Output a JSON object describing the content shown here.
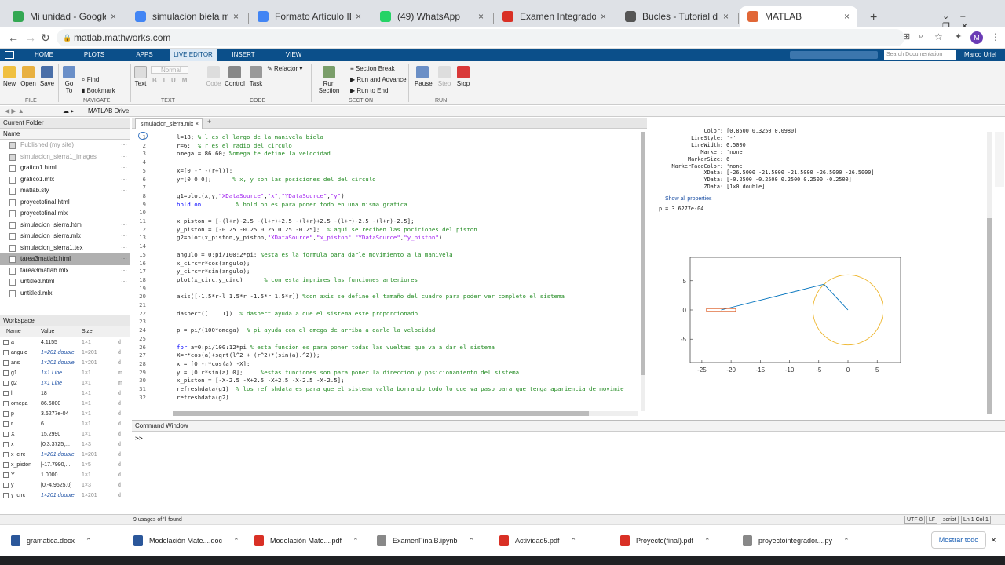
{
  "browser": {
    "tabs": [
      {
        "label": "Mi unidad - Google Drive",
        "color": "#34a853"
      },
      {
        "label": "simulacion biela manivela - Doc",
        "color": "#4285f4"
      },
      {
        "label": "Formato Artículo IEEE Eq. 4 - Do",
        "color": "#4285f4"
      },
      {
        "label": "(49) WhatsApp",
        "color": "#25d366"
      },
      {
        "label": "Examen Integrador - Parte práct",
        "color": "#d93025"
      },
      {
        "label": "Bucles - Tutorial de Python",
        "color": "#555555"
      },
      {
        "label": "MATLAB",
        "color": "#e16737"
      }
    ],
    "url": "matlab.mathworks.com",
    "new_tab": "+",
    "profile_initial": "M"
  },
  "matlab": {
    "tabs": [
      "HOME",
      "PLOTS",
      "APPS",
      "LIVE EDITOR",
      "INSERT",
      "VIEW"
    ],
    "search_placeholder": "Search Documentation",
    "user": "Marco Uriel",
    "toolstrip": {
      "file": [
        "New",
        "Open",
        "Save"
      ],
      "navigate": {
        "goto": "Go To",
        "find": "Find",
        "bookmark": "Bookmark"
      },
      "text": {
        "text": "Text",
        "style": "Normal",
        "fmt": [
          "B",
          "I",
          "U",
          "M"
        ]
      },
      "code": {
        "code": "Code",
        "control": "Control",
        "task": "Task",
        "refactor": "Refactor"
      },
      "section": [
        "Section Break",
        "Run and Advance",
        "Run to End"
      ],
      "run_section": "Run Section",
      "run": [
        "Pause",
        "Step",
        "Stop"
      ],
      "groups": [
        "FILE",
        "NAVIGATE",
        "TEXT",
        "CODE",
        "SECTION",
        "RUN"
      ]
    },
    "path": "MATLAB Drive",
    "current_folder": {
      "title": "Current Folder",
      "col_name": "Name",
      "files": [
        {
          "name": "Published (my site)",
          "dim": true
        },
        {
          "name": "simulacion_sierra1_images",
          "dim": true
        },
        {
          "name": "grafico1.html"
        },
        {
          "name": "grafico1.mlx"
        },
        {
          "name": "matlab.sty"
        },
        {
          "name": "proyectofinal.html"
        },
        {
          "name": "proyectofinal.mlx"
        },
        {
          "name": "simulacion_sierra.html"
        },
        {
          "name": "simulacion_sierra.mlx"
        },
        {
          "name": "simulacion_sierra1.tex"
        },
        {
          "name": "tarea3matlab.html",
          "selected": true
        },
        {
          "name": "tarea3matlab.mlx"
        },
        {
          "name": "untitled.html"
        },
        {
          "name": "untitled.mlx"
        }
      ]
    },
    "workspace": {
      "title": "Workspace",
      "headers": [
        "Name",
        "Value",
        "Size",
        ""
      ],
      "vars": [
        {
          "name": "a",
          "value": "4.1155",
          "size": "1×1",
          "cls": "d"
        },
        {
          "name": "angulo",
          "value": "1×201 double",
          "size": "1×201",
          "cls": "d",
          "link": true
        },
        {
          "name": "ans",
          "value": "1×201 double",
          "size": "1×201",
          "cls": "d",
          "link": true
        },
        {
          "name": "g1",
          "value": "1×1 Line",
          "size": "1×1",
          "cls": "m",
          "link": true
        },
        {
          "name": "g2",
          "value": "1×1 Line",
          "size": "1×1",
          "cls": "m",
          "link": true
        },
        {
          "name": "l",
          "value": "18",
          "size": "1×1",
          "cls": "d"
        },
        {
          "name": "omega",
          "value": "86.6000",
          "size": "1×1",
          "cls": "d"
        },
        {
          "name": "p",
          "value": "3.6277e-04",
          "size": "1×1",
          "cls": "d"
        },
        {
          "name": "r",
          "value": "6",
          "size": "1×1",
          "cls": "d"
        },
        {
          "name": "X",
          "value": "15.2990",
          "size": "1×1",
          "cls": "d"
        },
        {
          "name": "x",
          "value": "[0.3.3725,...",
          "size": "1×3",
          "cls": "d"
        },
        {
          "name": "x_circ",
          "value": "1×201 double",
          "size": "1×201",
          "cls": "d",
          "link": true
        },
        {
          "name": "x_piston",
          "value": "[-17.7990,...",
          "size": "1×5",
          "cls": "d"
        },
        {
          "name": "Y",
          "value": "1.0000",
          "size": "1×1",
          "cls": "d"
        },
        {
          "name": "y",
          "value": "[0,-4.9625,0]",
          "size": "1×3",
          "cls": "d"
        },
        {
          "name": "y_circ",
          "value": "1×201 double",
          "size": "1×201",
          "cls": "d",
          "link": true
        }
      ]
    },
    "editor_tab": "simulacion_sierra.mlx",
    "code_lines": [
      {
        "n": "1",
        "c": "l=18; % l es el largo de la manivela biela"
      },
      {
        "n": "2",
        "c": "r=6;  % r es el radio del circulo"
      },
      {
        "n": "3",
        "c": "omega = 86.60; %omega te define la velocidad"
      },
      {
        "n": "4",
        "c": ""
      },
      {
        "n": "5",
        "c": "x=[0 -r -(r+l)];"
      },
      {
        "n": "6",
        "c": "y=[0 0 0];      % x, y son las posiciones del del circulo"
      },
      {
        "n": "7",
        "c": ""
      },
      {
        "n": "8",
        "c": "g1=plot(x,y,\"XDataSource\",\"x\",\"YDataSource\",\"y\")"
      },
      {
        "n": "9",
        "c": "hold on          % hold on es para poner todo en una misma grafica"
      },
      {
        "n": "10",
        "c": ""
      },
      {
        "n": "11",
        "c": "x_piston = [-(l+r)-2.5 -(l+r)+2.5 -(l+r)+2.5 -(l+r)-2.5 -(l+r)-2.5];"
      },
      {
        "n": "12",
        "c": "y_piston = [-0.25 -0.25 0.25 0.25 -0.25];  % aqui se reciben las pociciones del piston"
      },
      {
        "n": "13",
        "c": "g2=plot(x_piston,y_piston,\"XDataSource\",\"x_piston\",\"YDataSource\",\"y_piston\")"
      },
      {
        "n": "14",
        "c": ""
      },
      {
        "n": "15",
        "c": "angulo = 0:pi/100:2*pi; %esta es la formula para darle movimiento a la manivela"
      },
      {
        "n": "16",
        "c": "x_circ=r*cos(angulo);"
      },
      {
        "n": "17",
        "c": "y_circ=r*sin(angulo);"
      },
      {
        "n": "18",
        "c": "plot(x_circ,y_circ)      % con esta imprimes las funciones anteriores"
      },
      {
        "n": "19",
        "c": ""
      },
      {
        "n": "20",
        "c": "axis([-1.5*r-l 1.5*r -1.5*r 1.5*r]) %con axis se define el tamaño del cuadro para poder ver completo el sistema"
      },
      {
        "n": "21",
        "c": ""
      },
      {
        "n": "22",
        "c": "daspect([1 1 1])  % daspect ayuda a que el sistema este proporcionado"
      },
      {
        "n": "23",
        "c": ""
      },
      {
        "n": "24",
        "c": "p = pi/(100*omega)  % pi ayuda con el omega de arriba a darle la velocidad"
      },
      {
        "n": "25",
        "c": ""
      },
      {
        "n": "26",
        "c": "for a=0:pi/100:12*pi % esta funcion es para poner todas las vueltas que va a dar el sistema"
      },
      {
        "n": "27",
        "c": "X=r*cos(a)+sqrt(l^2 + (r^2)*(sin(a).^2));"
      },
      {
        "n": "28",
        "c": "x = [0 -r*cos(a) -X];"
      },
      {
        "n": "29",
        "c": "y = [0 r*sin(a) 0];     %estas funciones son para poner la direccion y posicionamiento del sistema"
      },
      {
        "n": "30",
        "c": "x_piston = [-X-2.5 -X+2.5 -X+2.5 -X-2.5 -X-2.5];"
      },
      {
        "n": "31",
        "c": "refreshdata(g1)  % los refrshdata es para que el sistema valla borrando todo lo que va paso para que tenga apariencia de movimie"
      },
      {
        "n": "32",
        "c": "refreshdata(g2)"
      }
    ],
    "output_props": [
      "Color: [0.8500 0.3250 0.0980]",
      "LineStyle: '-'",
      "LineWidth: 0.5000",
      "Marker: 'none'",
      "MarkerSize: 6",
      "MarkerFaceColor: 'none'",
      "XData: [-26.5000 -21.5000 -21.5000 -26.5000 -26.5000]",
      "YData: [-0.2500 -0.2500 0.2500 0.2500 -0.2500]",
      "ZData: [1×0 double]"
    ],
    "show_all": "Show all properties",
    "p_output": "p = 3.6277e-04",
    "command_window": {
      "title": "Command Window",
      "prompt": ">>"
    },
    "status": {
      "left": "9 usages of 'l' found",
      "right": [
        "UTF-8",
        "LF",
        "script",
        "Ln 1 Col 1"
      ]
    }
  },
  "chart_data": {
    "type": "line",
    "title": "",
    "xlabel": "",
    "ylabel": "",
    "xlim": [
      -27,
      9
    ],
    "ylim": [
      -9,
      9
    ],
    "xticks": [
      -25,
      -20,
      -15,
      -10,
      -5,
      0,
      5
    ],
    "yticks": [
      5,
      0,
      -5
    ],
    "series": [
      {
        "x": [
          0,
          -4.1,
          -21.7
        ],
        "y": [
          0,
          4.4,
          0
        ],
        "color": "#0072bd"
      },
      {
        "x": [
          -24.2,
          -19.2,
          -19.2,
          -24.2,
          -24.2
        ],
        "y": [
          -0.25,
          -0.25,
          0.25,
          0.25,
          -0.25
        ],
        "color": "#d95319"
      },
      {
        "circle": {
          "cx": 0,
          "cy": 0,
          "r": 6
        },
        "color": "#edb120"
      }
    ]
  },
  "downloads": {
    "items": [
      {
        "name": "gramatica.docx",
        "color": "#2b579a"
      },
      {
        "name": "Modelación Mate....doc",
        "color": "#2b579a"
      },
      {
        "name": "Modelación Mate....pdf",
        "color": "#d93025"
      },
      {
        "name": "ExamenFinalB.ipynb",
        "color": "#888888"
      },
      {
        "name": "Actividad5.pdf",
        "color": "#d93025"
      },
      {
        "name": "Proyecto(final).pdf",
        "color": "#d93025"
      },
      {
        "name": "proyectointegrador....py",
        "color": "#888888"
      }
    ],
    "show_all": "Mostrar todo"
  }
}
